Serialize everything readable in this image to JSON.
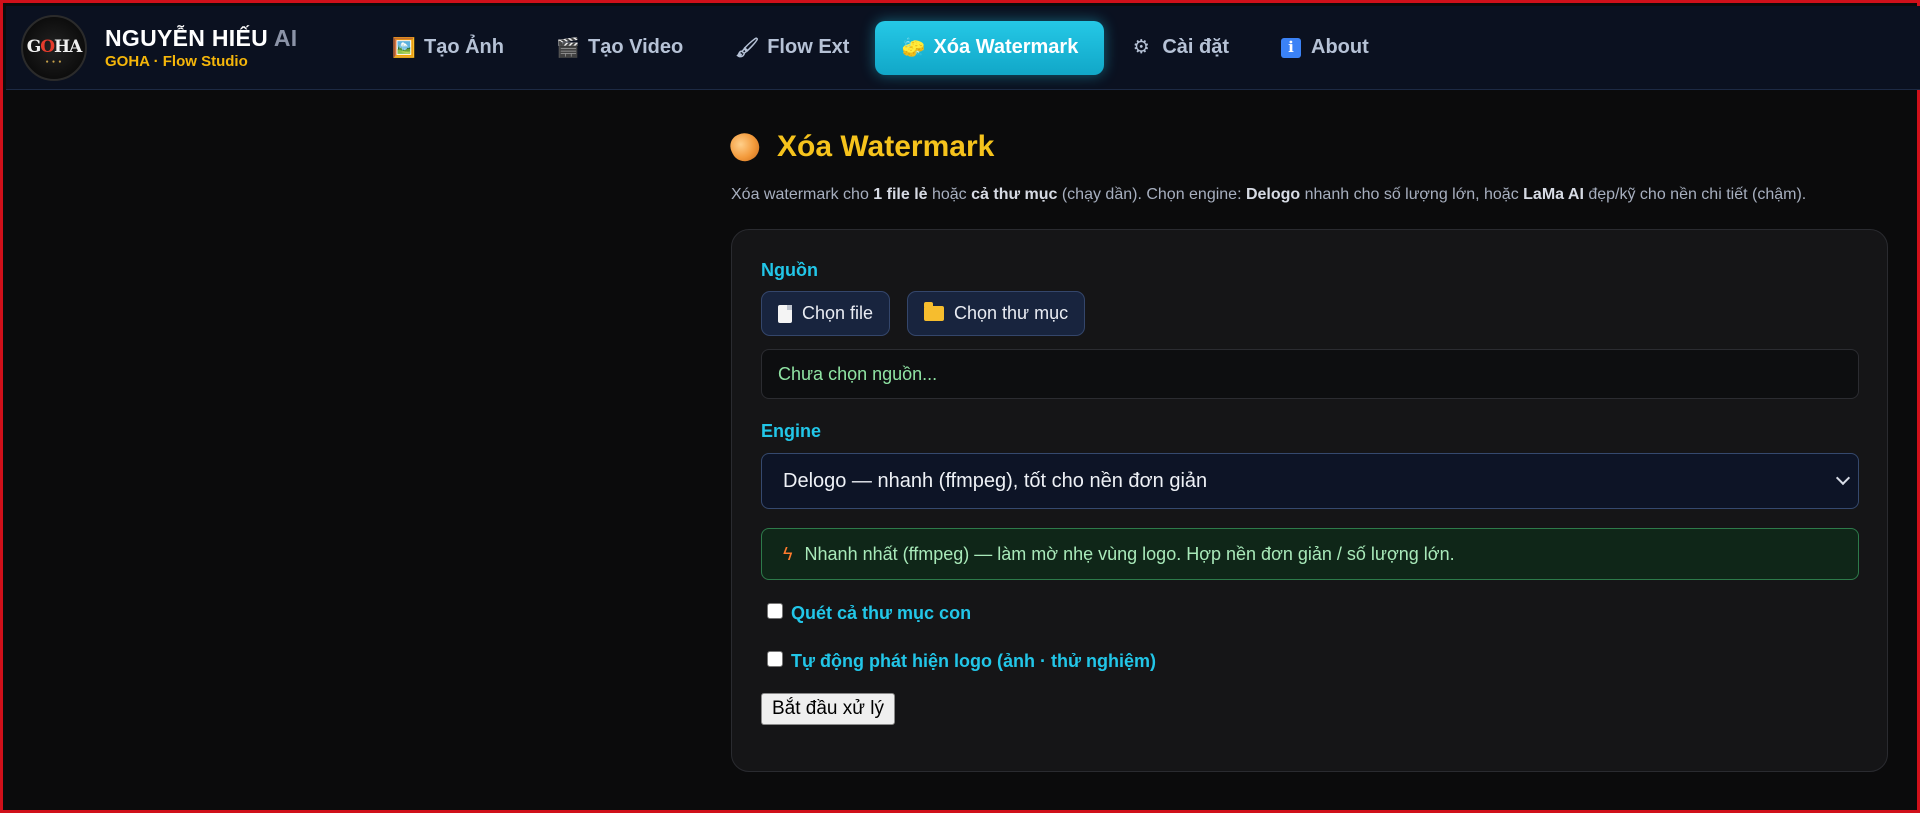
{
  "brand": {
    "logo_text": "GOHA",
    "title_main": "NGUYỄN HIẾU",
    "title_ai": "AI",
    "subtitle": "GOHA · Flow Studio"
  },
  "nav": {
    "items": [
      {
        "icon": "🖼️",
        "label": "Tạo Ảnh"
      },
      {
        "icon": "🎬",
        "label": "Tạo Video"
      },
      {
        "icon": "🖌",
        "label": "Flow Ext"
      },
      {
        "icon": "🧽",
        "label": "Xóa Watermark"
      },
      {
        "icon": "⚙",
        "label": "Cài đặt"
      },
      {
        "icon": "ℹ",
        "label": "About"
      }
    ],
    "active_index": 3
  },
  "page": {
    "title": "Xóa Watermark",
    "desc": {
      "p1": "Xóa watermark cho ",
      "b1": "1 file lẻ",
      "p2": " hoặc ",
      "b2": "cả thư mục",
      "p3": " (chạy dần). Chọn engine: ",
      "b3": "Delogo",
      "p4": " nhanh cho số lượng lớn, hoặc ",
      "b4": "LaMa AI",
      "p5": " đẹp/kỹ cho nền chi tiết (chậm)."
    }
  },
  "form": {
    "source_label": "Nguồn",
    "choose_file": "Chọn file",
    "choose_folder": "Chọn thư mục",
    "source_value": "Chưa chọn nguồn...",
    "engine_label": "Engine",
    "engine_selected": "Delogo — nhanh (ffmpeg), tốt cho nền đơn giản",
    "engine_info": "Nhanh nhất (ffmpeg) — làm mờ nhẹ vùng logo. Hợp nền đơn giản / số lượng lớn.",
    "scan_subfolders": "Quét cả thư mục con",
    "auto_detect": "Tự động phát hiện logo (ảnh · thử nghiệm)",
    "start_button": "Bắt đầu xử lý"
  },
  "colors": {
    "accent": "#22c6e8",
    "title": "#f6c31c",
    "frame": "#d0101a",
    "info_bg": "#0f2618"
  }
}
